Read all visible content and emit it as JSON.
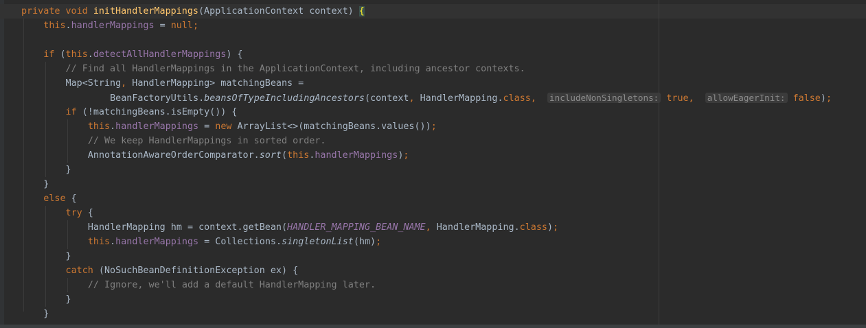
{
  "lines": [
    {
      "indent": 4,
      "tokens": [
        {
          "t": "private ",
          "c": "kw"
        },
        {
          "t": "void ",
          "c": "kw"
        },
        {
          "t": "initHandlerMappings",
          "c": "fn"
        },
        {
          "t": "(ApplicationContext context) ",
          "c": "plain"
        },
        {
          "t": "{",
          "c": "brace-hl"
        }
      ]
    },
    {
      "indent": 8,
      "tokens": [
        {
          "t": "this",
          "c": "kw"
        },
        {
          "t": ".",
          "c": "plain"
        },
        {
          "t": "handlerMappings",
          "c": "field"
        },
        {
          "t": " = ",
          "c": "plain"
        },
        {
          "t": "null",
          "c": "kw"
        },
        {
          "t": ";",
          "c": "punct"
        }
      ]
    },
    {
      "indent": 0,
      "tokens": []
    },
    {
      "indent": 8,
      "tokens": [
        {
          "t": "if ",
          "c": "kw"
        },
        {
          "t": "(",
          "c": "plain"
        },
        {
          "t": "this",
          "c": "kw"
        },
        {
          "t": ".",
          "c": "plain"
        },
        {
          "t": "detectAllHandlerMappings",
          "c": "field"
        },
        {
          "t": ") {",
          "c": "plain"
        }
      ]
    },
    {
      "indent": 12,
      "tokens": [
        {
          "t": "// Find all HandlerMappings in the ApplicationContext, including ancestor contexts.",
          "c": "cmt"
        }
      ]
    },
    {
      "indent": 12,
      "tokens": [
        {
          "t": "Map<String",
          "c": "plain"
        },
        {
          "t": ", ",
          "c": "punct"
        },
        {
          "t": "HandlerMapping> matchingBeans =",
          "c": "plain"
        }
      ]
    },
    {
      "indent": 20,
      "tokens": [
        {
          "t": "BeanFactoryUtils.",
          "c": "plain"
        },
        {
          "t": "beansOfTypeIncludingAncestors",
          "c": "static"
        },
        {
          "t": "(context",
          "c": "plain"
        },
        {
          "t": ", ",
          "c": "punct"
        },
        {
          "t": "HandlerMapping.",
          "c": "plain"
        },
        {
          "t": "class",
          "c": "kw"
        },
        {
          "t": ",  ",
          "c": "punct"
        },
        {
          "t": "includeNonSingletons:",
          "c": "hint"
        },
        {
          "t": " ",
          "c": "plain"
        },
        {
          "t": "true",
          "c": "kw"
        },
        {
          "t": ",  ",
          "c": "punct"
        },
        {
          "t": "allowEagerInit:",
          "c": "hint"
        },
        {
          "t": " ",
          "c": "plain"
        },
        {
          "t": "false",
          "c": "kw"
        },
        {
          "t": ")",
          "c": "plain"
        },
        {
          "t": ";",
          "c": "punct"
        }
      ]
    },
    {
      "indent": 12,
      "tokens": [
        {
          "t": "if ",
          "c": "kw"
        },
        {
          "t": "(!matchingBeans.isEmpty()) {",
          "c": "plain"
        }
      ]
    },
    {
      "indent": 16,
      "tokens": [
        {
          "t": "this",
          "c": "kw"
        },
        {
          "t": ".",
          "c": "plain"
        },
        {
          "t": "handlerMappings",
          "c": "field"
        },
        {
          "t": " = ",
          "c": "plain"
        },
        {
          "t": "new ",
          "c": "kw"
        },
        {
          "t": "ArrayList<>(matchingBeans.values())",
          "c": "plain"
        },
        {
          "t": ";",
          "c": "punct"
        }
      ]
    },
    {
      "indent": 16,
      "tokens": [
        {
          "t": "// We keep HandlerMappings in sorted order.",
          "c": "cmt"
        }
      ]
    },
    {
      "indent": 16,
      "tokens": [
        {
          "t": "AnnotationAwareOrderComparator.",
          "c": "plain"
        },
        {
          "t": "sort",
          "c": "static"
        },
        {
          "t": "(",
          "c": "plain"
        },
        {
          "t": "this",
          "c": "kw"
        },
        {
          "t": ".",
          "c": "plain"
        },
        {
          "t": "handlerMappings",
          "c": "field"
        },
        {
          "t": ")",
          "c": "plain"
        },
        {
          "t": ";",
          "c": "punct"
        }
      ]
    },
    {
      "indent": 12,
      "tokens": [
        {
          "t": "}",
          "c": "plain"
        }
      ]
    },
    {
      "indent": 8,
      "tokens": [
        {
          "t": "}",
          "c": "plain"
        }
      ]
    },
    {
      "indent": 8,
      "tokens": [
        {
          "t": "else ",
          "c": "kw"
        },
        {
          "t": "{",
          "c": "plain"
        }
      ]
    },
    {
      "indent": 12,
      "tokens": [
        {
          "t": "try ",
          "c": "kw"
        },
        {
          "t": "{",
          "c": "plain"
        }
      ]
    },
    {
      "indent": 16,
      "tokens": [
        {
          "t": "HandlerMapping hm = context.getBean(",
          "c": "plain"
        },
        {
          "t": "HANDLER_MAPPING_BEAN_NAME",
          "c": "const"
        },
        {
          "t": ", ",
          "c": "punct"
        },
        {
          "t": "HandlerMapping.",
          "c": "plain"
        },
        {
          "t": "class",
          "c": "kw"
        },
        {
          "t": ")",
          "c": "plain"
        },
        {
          "t": ";",
          "c": "punct"
        }
      ]
    },
    {
      "indent": 16,
      "tokens": [
        {
          "t": "this",
          "c": "kw"
        },
        {
          "t": ".",
          "c": "plain"
        },
        {
          "t": "handlerMappings",
          "c": "field"
        },
        {
          "t": " = Collections.",
          "c": "plain"
        },
        {
          "t": "singletonList",
          "c": "static"
        },
        {
          "t": "(hm)",
          "c": "plain"
        },
        {
          "t": ";",
          "c": "punct"
        }
      ]
    },
    {
      "indent": 12,
      "tokens": [
        {
          "t": "}",
          "c": "plain"
        }
      ]
    },
    {
      "indent": 12,
      "tokens": [
        {
          "t": "catch ",
          "c": "kw"
        },
        {
          "t": "(NoSuchBeanDefinitionException ex) {",
          "c": "plain"
        }
      ]
    },
    {
      "indent": 16,
      "tokens": [
        {
          "t": "// Ignore, we'll add a default HandlerMapping later.",
          "c": "cmt"
        }
      ]
    },
    {
      "indent": 12,
      "tokens": [
        {
          "t": "}",
          "c": "plain"
        }
      ]
    },
    {
      "indent": 8,
      "tokens": [
        {
          "t": "}",
          "c": "plain"
        }
      ]
    }
  ]
}
